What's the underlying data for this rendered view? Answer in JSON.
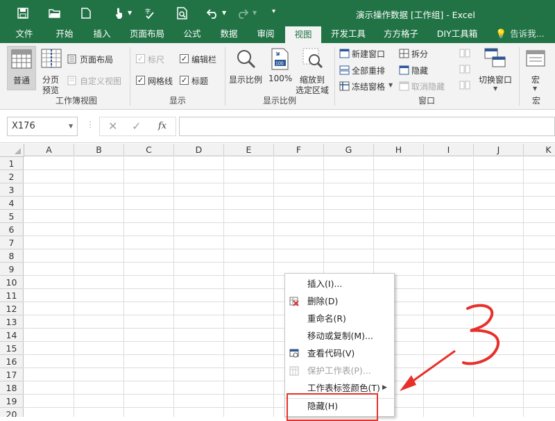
{
  "app": {
    "window_title": "演示操作数据 [工作组] - Excel",
    "brand_color": "#217346"
  },
  "quick_access": {
    "icons": [
      "save-icon",
      "open-folder-icon",
      "new-file-icon",
      "touch-mode-icon",
      "spell-check-icon",
      "print-preview-icon",
      "undo-icon",
      "redo-icon",
      "customize-toolbar-icon"
    ]
  },
  "tabs": [
    {
      "label": "文件"
    },
    {
      "label": "开始"
    },
    {
      "label": "插入"
    },
    {
      "label": "页面布局"
    },
    {
      "label": "公式"
    },
    {
      "label": "数据"
    },
    {
      "label": "审阅"
    },
    {
      "label": "视图",
      "active": true
    },
    {
      "label": "开发工具"
    },
    {
      "label": "方方格子"
    },
    {
      "label": "DIY工具箱"
    },
    {
      "label": "告诉我..."
    }
  ],
  "ribbon": {
    "workbook_views": {
      "group_label": "工作簿视图",
      "normal": "普通",
      "page_break_1": "分页",
      "page_break_2": "预览",
      "page_layout": "页面布局",
      "custom_views": "自定义视图"
    },
    "show": {
      "group_label": "显示",
      "ruler": "标尺",
      "ruler_checked": true,
      "ruler_disabled": true,
      "formula_bar": "编辑栏",
      "formula_bar_checked": true,
      "gridlines": "网格线",
      "gridlines_checked": true,
      "headings": "标题",
      "headings_checked": true
    },
    "zoom": {
      "group_label": "显示比例",
      "zoom": "显示比例",
      "hundred": "100%",
      "zoom_sel_1": "缩放到",
      "zoom_sel_2": "选定区域"
    },
    "window": {
      "group_label": "窗口",
      "new_window": "新建窗口",
      "arrange_all": "全部重排",
      "freeze_panes": "冻结窗格",
      "split": "拆分",
      "hide": "隐藏",
      "unhide": "取消隐藏",
      "switch_windows": "切换窗口"
    },
    "macros": {
      "group_label": "宏",
      "macros": "宏"
    }
  },
  "formula_bar": {
    "name_box": "X176",
    "fx": "fx",
    "value": ""
  },
  "columns": [
    "A",
    "B",
    "C",
    "D",
    "E",
    "F",
    "G",
    "H",
    "I",
    "J",
    "K"
  ],
  "rows": [
    "1",
    "2",
    "3",
    "4",
    "5",
    "6",
    "7",
    "8",
    "9",
    "10",
    "11",
    "12",
    "13",
    "14",
    "15",
    "16",
    "17",
    "18",
    "19",
    "20"
  ],
  "context_menu": {
    "items": [
      {
        "label": "插入(I)...",
        "icon": ""
      },
      {
        "label": "删除(D)",
        "icon": "delete-sheet-icon"
      },
      {
        "label": "重命名(R)",
        "icon": ""
      },
      {
        "label": "移动或复制(M)...",
        "icon": ""
      },
      {
        "label": "查看代码(V)",
        "icon": "view-code-icon"
      },
      {
        "label": "保护工作表(P)...",
        "icon": "protect-sheet-icon",
        "disabled": true
      },
      {
        "label": "工作表标签颜色(T)",
        "icon": "",
        "submenu": true
      },
      {
        "label": "隐藏(H)",
        "icon": "",
        "highlighted": true
      }
    ]
  },
  "annotation": {
    "handwritten_number": "3",
    "color": "#e8302a"
  }
}
